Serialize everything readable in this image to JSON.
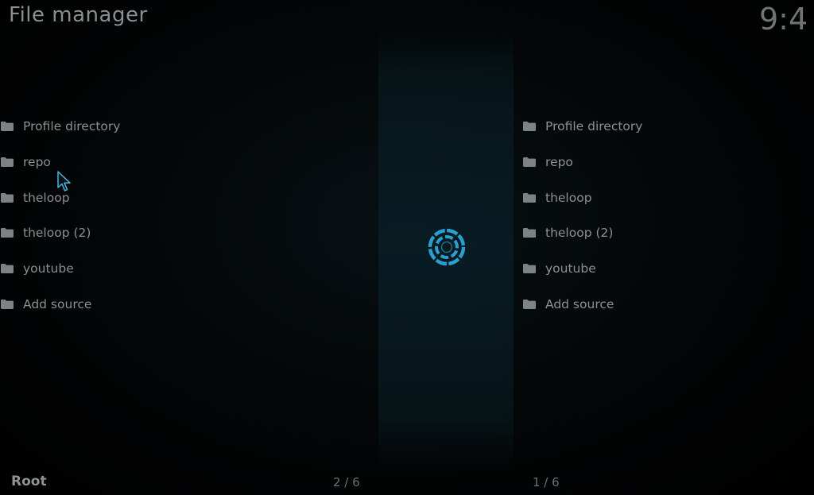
{
  "header": {
    "title": "File manager",
    "clock": "9:4"
  },
  "left_pane": {
    "items": [
      {
        "label": "Profile directory",
        "icon": "folder-icon"
      },
      {
        "label": "repo",
        "icon": "folder-icon"
      },
      {
        "label": "theloop",
        "icon": "folder-icon"
      },
      {
        "label": "theloop (2)",
        "icon": "folder-icon"
      },
      {
        "label": "youtube",
        "icon": "folder-icon"
      },
      {
        "label": "Add source",
        "icon": "folder-icon"
      }
    ],
    "count": "2 / 6"
  },
  "right_pane": {
    "items": [
      {
        "label": "Profile directory",
        "icon": "folder-icon"
      },
      {
        "label": "repo",
        "icon": "folder-icon"
      },
      {
        "label": "theloop",
        "icon": "folder-icon"
      },
      {
        "label": "theloop (2)",
        "icon": "folder-icon"
      },
      {
        "label": "youtube",
        "icon": "folder-icon"
      },
      {
        "label": "Add source",
        "icon": "folder-icon"
      }
    ],
    "count": "1 / 6"
  },
  "footer": {
    "path": "Root"
  },
  "colors": {
    "accent": "#2a9fd0",
    "text": "#8c9093",
    "background": "#000000"
  },
  "busy_indicator": "loading-spinner-icon"
}
